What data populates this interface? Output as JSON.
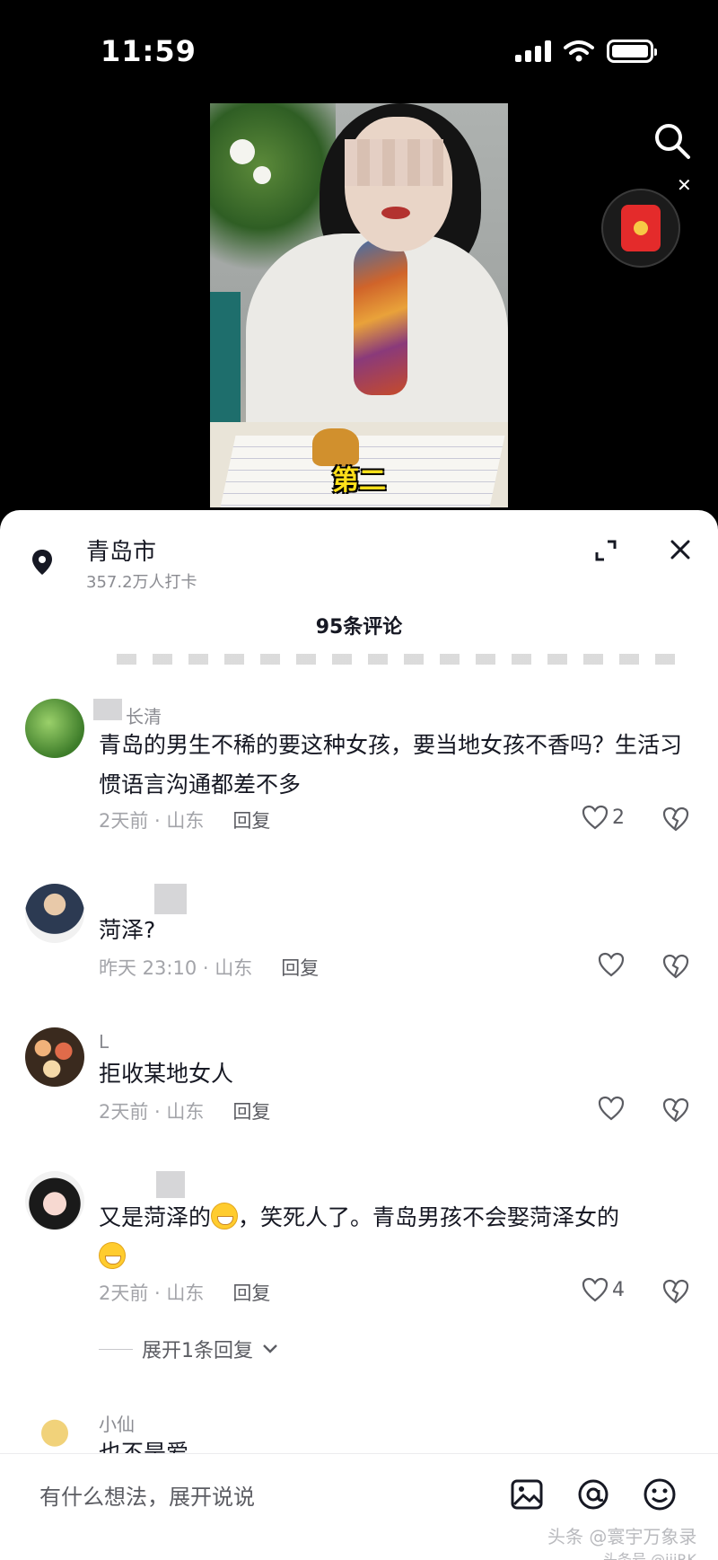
{
  "status_bar": {
    "time": "11:59"
  },
  "video": {
    "subtitle": "第二"
  },
  "location": {
    "name": "青岛市",
    "checkins": "357.2万人打卡"
  },
  "comments_header": {
    "count_label": "95条评论"
  },
  "comments": [
    {
      "name": "长清",
      "text": "青岛的男生不稀的要这种女孩，要当地女孩不香吗？生活习惯语言沟通都差不多",
      "time": "2天前 · 山东",
      "reply_label": "回复",
      "likes": "2"
    },
    {
      "name": "",
      "text": "菏泽?",
      "time": "昨天 23:10 · 山东",
      "reply_label": "回复",
      "likes": ""
    },
    {
      "name": "L",
      "text": "拒收某地女人",
      "time": "2天前 · 山东",
      "reply_label": "回复",
      "likes": ""
    },
    {
      "name": "",
      "text_part1": "又是菏泽的",
      "text_part2": "，笑死人了。青岛男孩不会娶菏泽女的",
      "time": "2天前 · 山东",
      "reply_label": "回复",
      "likes": "4",
      "expand_label": "展开1条回复"
    },
    {
      "name": "小仙",
      "text": "也不是爱"
    }
  ],
  "input_bar": {
    "placeholder": "有什么想法，展开说说"
  },
  "watermark": {
    "line1": "头条 @寰宇万象录",
    "line2": "头条号 @ijiRK"
  },
  "colors": {
    "accent": "#161823",
    "redpacket": "#e42b2b",
    "subtitle": "#ffe01a"
  },
  "icons": [
    "search-icon",
    "redpacket-icon",
    "location-pin-icon",
    "expand-icon",
    "close-icon",
    "heart-icon",
    "broken-heart-icon",
    "image-icon",
    "at-icon",
    "smiley-icon",
    "chevron-down-icon"
  ]
}
